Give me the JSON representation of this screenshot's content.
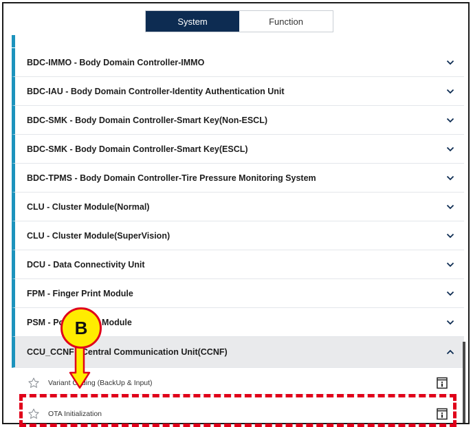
{
  "tabs": [
    {
      "label": "System",
      "active": true
    },
    {
      "label": "Function",
      "active": false
    }
  ],
  "systems": [
    {
      "label": "BDC-IMMO - Body Domain Controller-IMMO"
    },
    {
      "label": "BDC-IAU - Body Domain Controller-Identity Authentication Unit"
    },
    {
      "label": "BDC-SMK - Body Domain Controller-Smart Key(Non-ESCL)"
    },
    {
      "label": "BDC-SMK - Body Domain Controller-Smart Key(ESCL)"
    },
    {
      "label": "BDC-TPMS - Body Domain Controller-Tire Pressure Monitoring System"
    },
    {
      "label": "CLU - Cluster Module(Normal)"
    },
    {
      "label": "CLU - Cluster Module(SuperVision)"
    },
    {
      "label": "DCU - Data Connectivity Unit"
    },
    {
      "label": "FPM - Finger Print Module"
    },
    {
      "label": "PSM - Power Seat Module"
    },
    {
      "label": "CCU_CCNF - Central Communication Unit(CCNF)"
    }
  ],
  "functions": [
    {
      "label": "Variant Coding (BackUp & Input)"
    },
    {
      "label": "OTA Initialization"
    }
  ],
  "callout": {
    "label": "B"
  },
  "colors": {
    "accent": "#1c93bd",
    "active_tab": "#0d2c52",
    "highlight": "#e0001a",
    "callout_fill": "#ffec00"
  }
}
